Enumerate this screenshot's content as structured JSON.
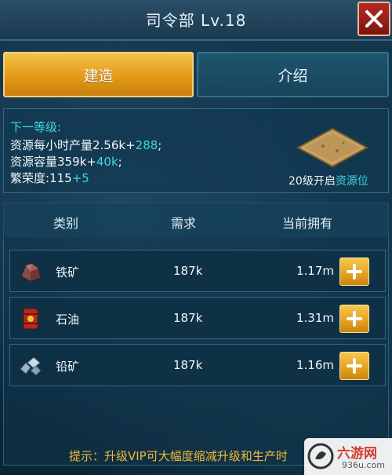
{
  "header": {
    "title": "司令部 Lv.18"
  },
  "tabs": {
    "build": "建造",
    "intro": "介绍"
  },
  "info": {
    "next_level_label": "下一等级:",
    "line1_text": "资源每小时产量2.56k+",
    "line1_plus": "288",
    "line1_end": ";",
    "line2_text": "资源容量359k+",
    "line2_plus": "40k",
    "line2_end": ";",
    "line3_text": "繁荣度:115",
    "line3_plus": "+5",
    "unlock_text": "20级开启",
    "unlock_highlight": "资源位"
  },
  "table": {
    "headers": {
      "category": "类别",
      "need": "需求",
      "have": "当前拥有"
    },
    "rows": [
      {
        "name": "铁矿",
        "need": "187k",
        "have": "1.17m",
        "icon": "iron-ore-icon"
      },
      {
        "name": "石油",
        "need": "187k",
        "have": "1.31m",
        "icon": "oil-barrel-icon"
      },
      {
        "name": "铅矿",
        "need": "187k",
        "have": "1.16m",
        "icon": "lead-ore-icon"
      }
    ]
  },
  "tip": "提示：升级VIP可大幅度缩减升级和生产时",
  "watermark": {
    "name": "六游网",
    "url": "936u.com"
  },
  "colors": {
    "accent_cyan": "#3fd7e0",
    "gold": "#e39a18",
    "tip": "#f1b93a",
    "close_red": "#b52a22"
  }
}
